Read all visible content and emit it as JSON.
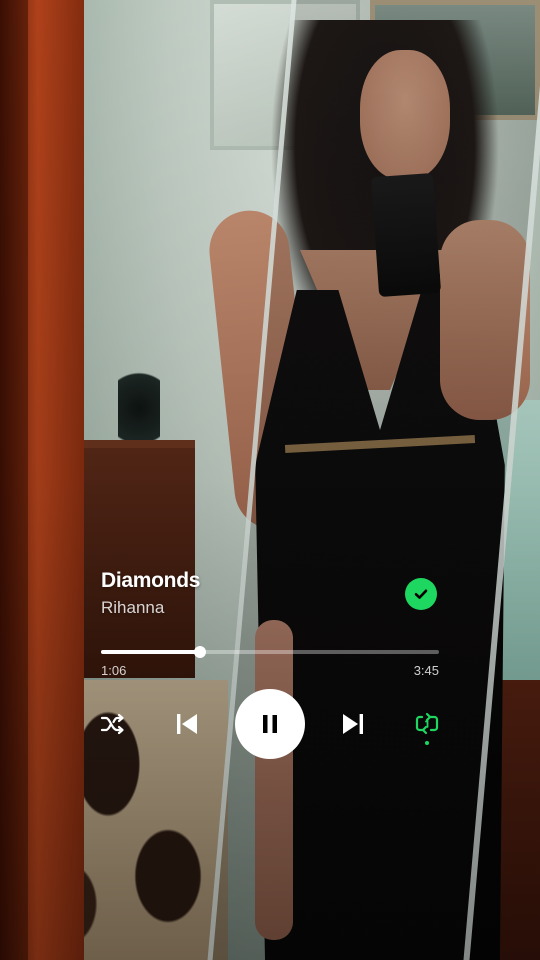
{
  "now_playing": {
    "title": "Diamonds",
    "artist": "Rihanna",
    "liked": true,
    "elapsed": "1:06",
    "duration": "3:45",
    "progress": 0.293,
    "is_playing": true,
    "shuffle": false,
    "repeat": "one"
  },
  "icons": {
    "liked": "check-circle-icon",
    "shuffle": "shuffle-icon",
    "previous": "skip-previous-icon",
    "play_pause": "pause-icon",
    "next": "skip-next-icon",
    "repeat": "repeat-one-icon"
  },
  "colors": {
    "accent": "#1ed760",
    "text_primary": "#ffffff",
    "track_bg": "rgba(255,255,255,0.35)"
  }
}
